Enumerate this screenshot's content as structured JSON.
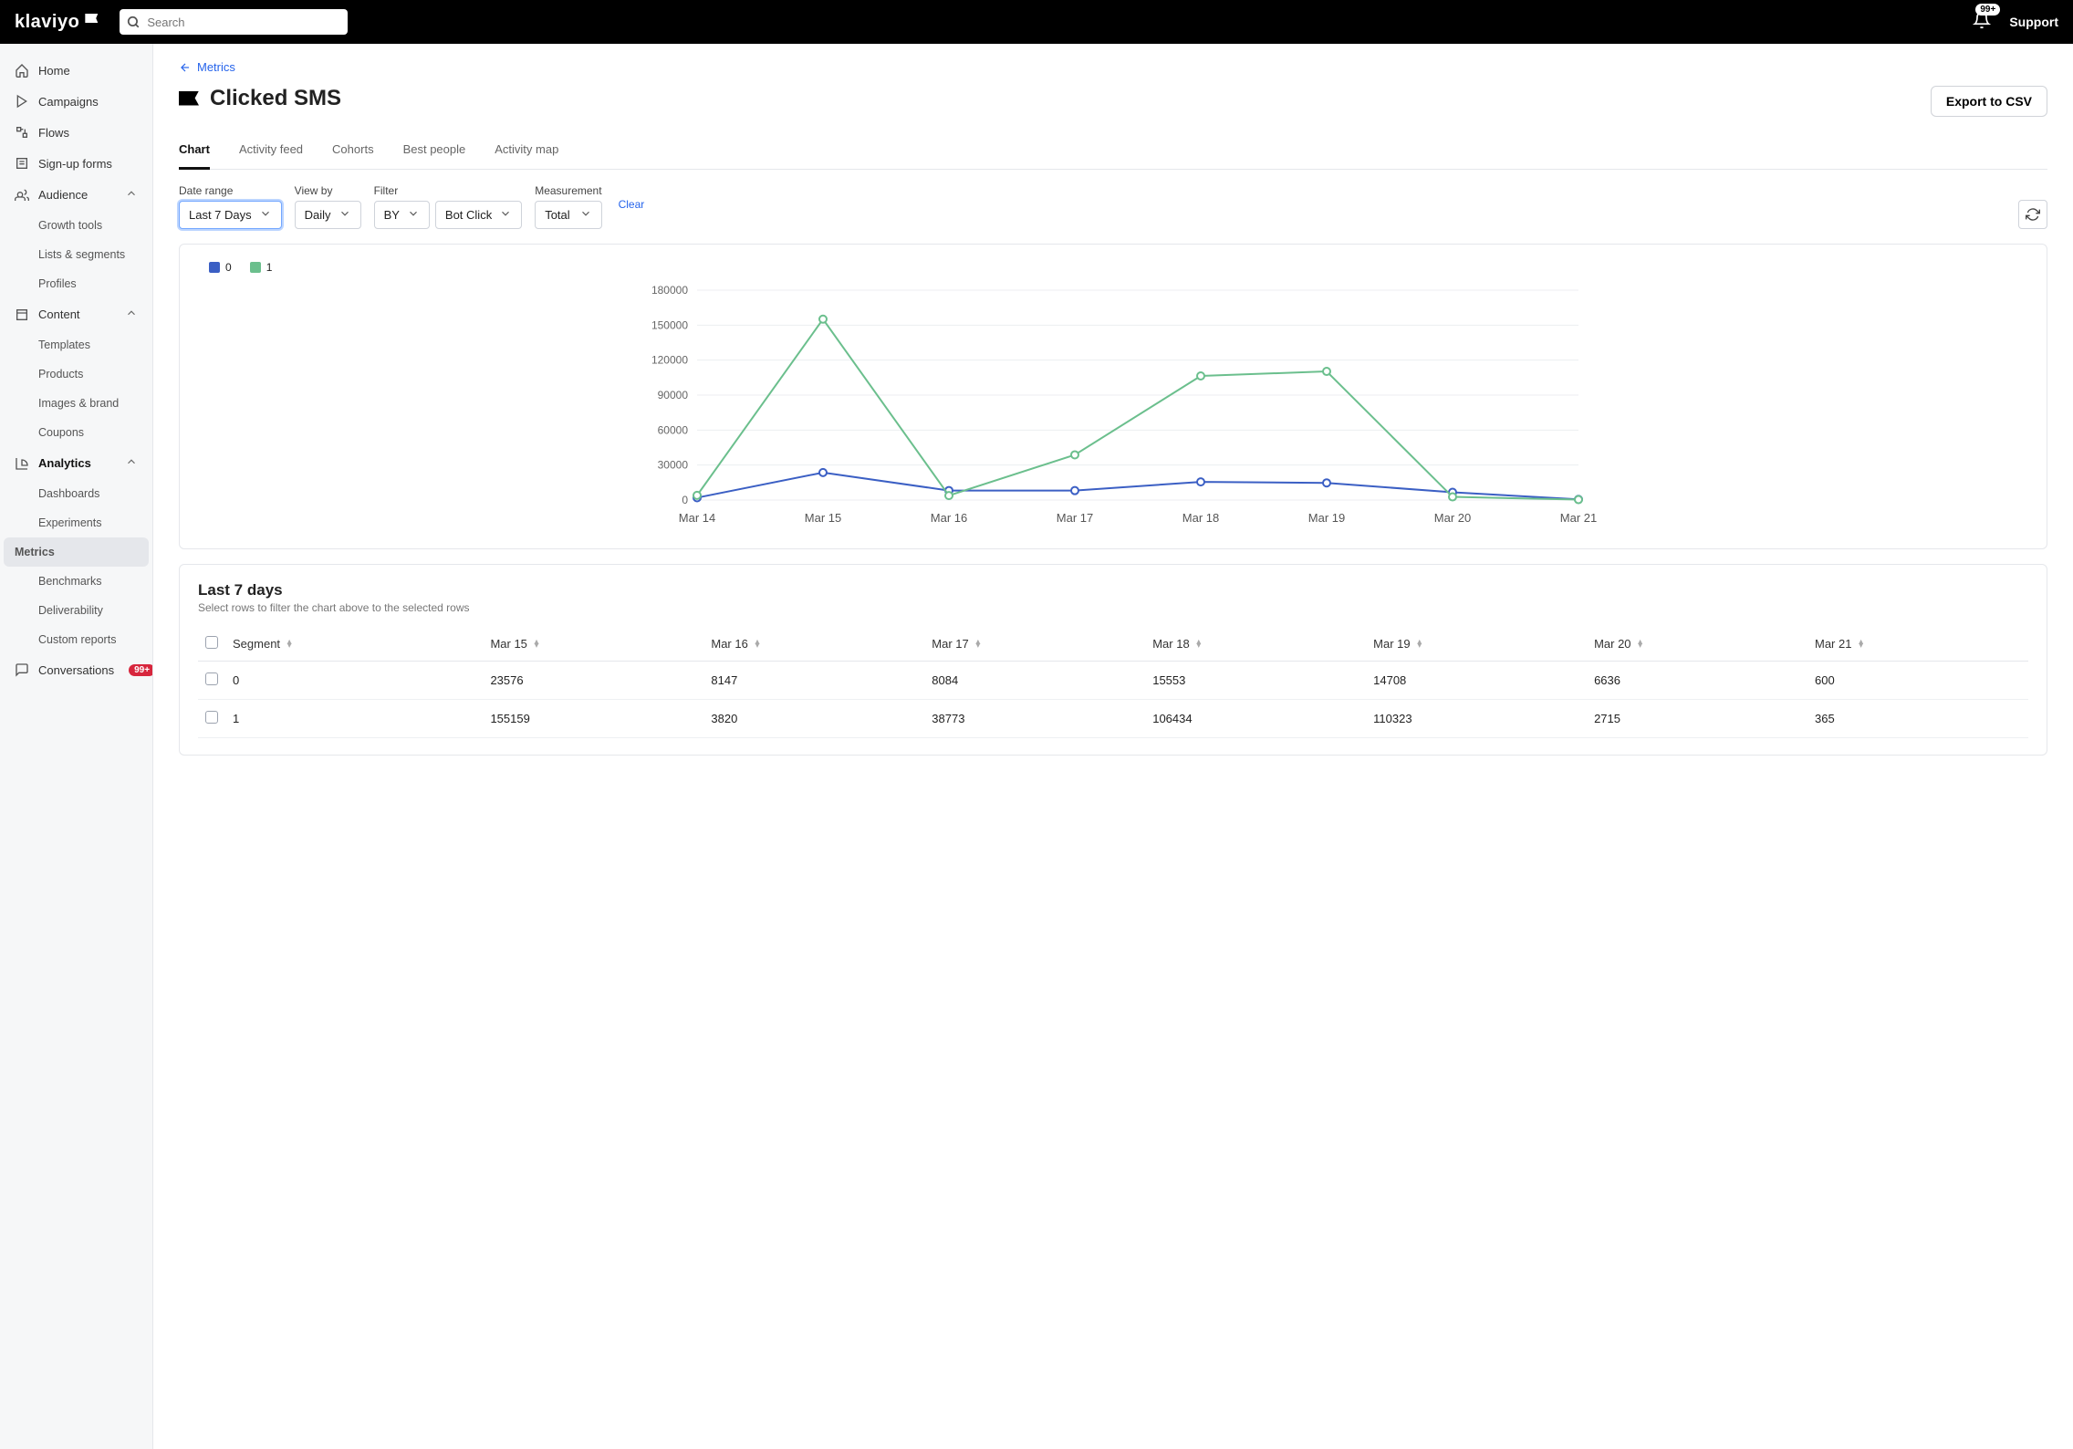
{
  "topbar": {
    "logo_text": "klaviyo",
    "search_placeholder": "Search",
    "notif_badge": "99+",
    "support": "Support"
  },
  "sidebar": {
    "items": [
      {
        "label": "Home"
      },
      {
        "label": "Campaigns"
      },
      {
        "label": "Flows"
      },
      {
        "label": "Sign-up forms"
      },
      {
        "label": "Audience",
        "expandable": true
      },
      {
        "label": "Growth tools",
        "sub": true
      },
      {
        "label": "Lists & segments",
        "sub": true
      },
      {
        "label": "Profiles",
        "sub": true
      },
      {
        "label": "Content",
        "expandable": true
      },
      {
        "label": "Templates",
        "sub": true
      },
      {
        "label": "Products",
        "sub": true
      },
      {
        "label": "Images & brand",
        "sub": true
      },
      {
        "label": "Coupons",
        "sub": true
      },
      {
        "label": "Analytics",
        "expandable": true,
        "bold": true
      },
      {
        "label": "Dashboards",
        "sub": true
      },
      {
        "label": "Experiments",
        "sub": true
      },
      {
        "label": "Metrics",
        "sub": true,
        "active": true
      },
      {
        "label": "Benchmarks",
        "sub": true
      },
      {
        "label": "Deliverability",
        "sub": true
      },
      {
        "label": "Custom reports",
        "sub": true
      },
      {
        "label": "Conversations",
        "badge": "99+"
      }
    ]
  },
  "breadcrumb": {
    "back": "Metrics"
  },
  "page": {
    "title": "Clicked SMS",
    "export": "Export to CSV"
  },
  "tabs": [
    "Chart",
    "Activity feed",
    "Cohorts",
    "Best people",
    "Activity map"
  ],
  "active_tab": 0,
  "filters": {
    "date_range": {
      "label": "Date range",
      "value": "Last 7 Days"
    },
    "view_by": {
      "label": "View by",
      "value": "Daily"
    },
    "filter": {
      "label": "Filter",
      "value": "BY",
      "extra": "Bot Click"
    },
    "measurement": {
      "label": "Measurement",
      "value": "Total"
    },
    "clear": "Clear"
  },
  "chart_data": {
    "type": "line",
    "categories": [
      "Mar 14",
      "Mar 15",
      "Mar 16",
      "Mar 17",
      "Mar 18",
      "Mar 19",
      "Mar 20",
      "Mar 21"
    ],
    "series": [
      {
        "name": "0",
        "color": "#3b5fc4",
        "values": [
          2000,
          23576,
          8147,
          8084,
          15553,
          14708,
          6636,
          600
        ]
      },
      {
        "name": "1",
        "color": "#6bbf8d",
        "values": [
          4000,
          155159,
          3820,
          38773,
          106434,
          110323,
          2715,
          365
        ]
      }
    ],
    "ylim": [
      0,
      180000
    ],
    "yticks": [
      0,
      30000,
      60000,
      90000,
      120000,
      150000,
      180000
    ]
  },
  "table": {
    "title": "Last 7 days",
    "subtitle": "Select rows to filter the chart above to the selected rows",
    "header_segment": "Segment",
    "columns": [
      "Mar 15",
      "Mar 16",
      "Mar 17",
      "Mar 18",
      "Mar 19",
      "Mar 20",
      "Mar 21"
    ],
    "rows": [
      {
        "segment": "0",
        "cells": [
          "23576",
          "8147",
          "8084",
          "15553",
          "14708",
          "6636",
          "600"
        ]
      },
      {
        "segment": "1",
        "cells": [
          "155159",
          "3820",
          "38773",
          "106434",
          "110323",
          "2715",
          "365"
        ]
      }
    ]
  }
}
